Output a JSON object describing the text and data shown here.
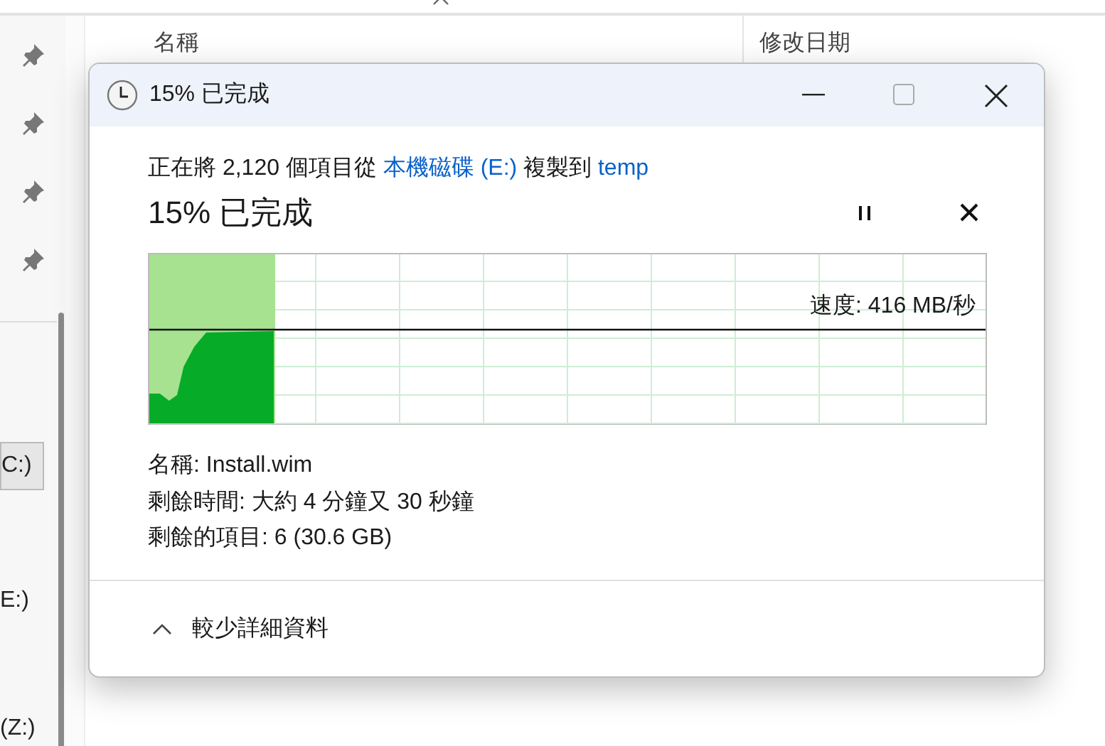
{
  "explorer": {
    "nav_items": [
      {
        "label": "C:)",
        "selected": true
      },
      {
        "label": "E:)",
        "selected": false
      },
      {
        "label": "(Z:)",
        "selected": false
      }
    ],
    "columns": [
      {
        "label": "名稱"
      },
      {
        "label": "修改日期"
      }
    ]
  },
  "dialog": {
    "title": "15% 已完成",
    "description": [
      {
        "kind": "text",
        "text": "正在將 2,120 個項目從 "
      },
      {
        "kind": "link",
        "text": "本機磁碟 (E:)"
      },
      {
        "kind": "text",
        "text": " 複製到 "
      },
      {
        "kind": "link",
        "text": "temp"
      }
    ],
    "heading": "15% 已完成",
    "progress": {
      "level": 0.15,
      "speed": "速度: 416 MB/秒"
    },
    "details": [
      {
        "label": "名稱:",
        "value": "Install.wim"
      },
      {
        "label": "剩餘時間:",
        "value": "大約 4 分鐘又 30 秒鐘"
      },
      {
        "label": "剩餘的項目:",
        "value": "6 (30.6 GB)"
      }
    ],
    "details_toggle": {
      "label": "較少詳細資料",
      "expanded": true
    }
  }
}
